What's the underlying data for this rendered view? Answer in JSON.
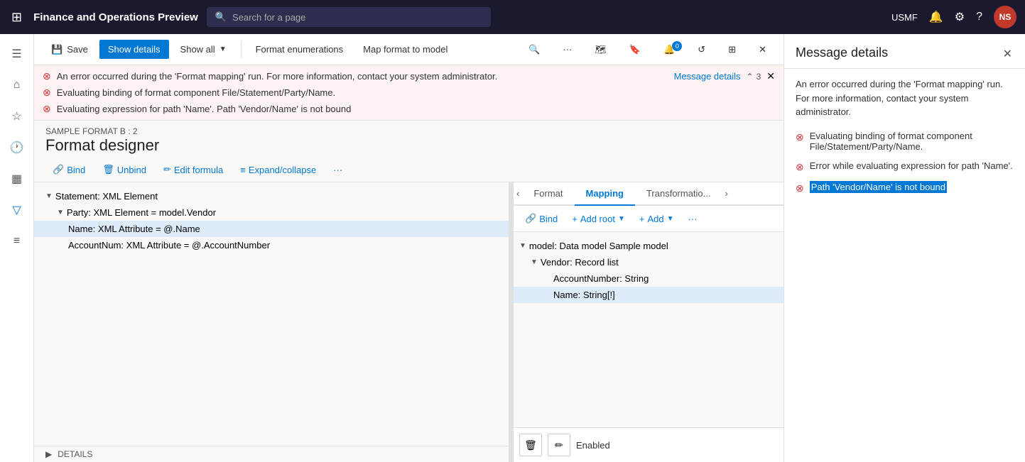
{
  "app": {
    "title": "Finance and Operations Preview",
    "nav_icon": "⊞",
    "search_placeholder": "Search for a page",
    "usmf_label": "USMF",
    "avatar_initials": "NS"
  },
  "sidebar": {
    "items": [
      {
        "icon": "☰",
        "name": "menu"
      },
      {
        "icon": "⌂",
        "name": "home"
      },
      {
        "icon": "☆",
        "name": "favorites"
      },
      {
        "icon": "⏱",
        "name": "recent"
      },
      {
        "icon": "▦",
        "name": "workspaces"
      },
      {
        "icon": "≡",
        "name": "modules"
      }
    ]
  },
  "toolbar": {
    "save_label": "Save",
    "show_details_label": "Show details",
    "show_all_label": "Show all",
    "format_enums_label": "Format enumerations",
    "map_format_label": "Map format to model"
  },
  "error_banner": {
    "error1": "An error occurred during the 'Format mapping' run. For more information, contact your system administrator.",
    "error2": "Evaluating binding of format component File/Statement/Party/Name.",
    "error3": "Evaluating expression for path 'Name'.  Path 'Vendor/Name' is not bound",
    "message_details_link": "Message details",
    "error_count": "3"
  },
  "designer": {
    "subtitle": "SAMPLE FORMAT B : 2",
    "title": "Format designer"
  },
  "designer_toolbar": {
    "bind_label": "Bind",
    "unbind_label": "Unbind",
    "edit_formula_label": "Edit formula",
    "expand_collapse_label": "Expand/collapse"
  },
  "format_tree": {
    "items": [
      {
        "label": "Statement: XML Element",
        "level": 0,
        "has_arrow": true,
        "arrow": "▼"
      },
      {
        "label": "Party: XML Element = model.Vendor",
        "level": 1,
        "has_arrow": true,
        "arrow": "▼"
      },
      {
        "label": "Name: XML Attribute = @.Name",
        "level": 2,
        "has_arrow": false,
        "selected": true
      },
      {
        "label": "AccountNum: XML Attribute = @.AccountNumber",
        "level": 2,
        "has_arrow": false
      }
    ]
  },
  "mapping_tabs": {
    "format_label": "Format",
    "mapping_label": "Mapping",
    "transformation_label": "Transformatio..."
  },
  "mapping_toolbar": {
    "bind_label": "Bind",
    "add_root_label": "Add root",
    "add_label": "Add"
  },
  "mapping_tree": {
    "items": [
      {
        "label": "model: Data model Sample model",
        "level": 0,
        "has_arrow": true,
        "arrow": "▼"
      },
      {
        "label": "Vendor: Record list",
        "level": 1,
        "has_arrow": true,
        "arrow": "▼"
      },
      {
        "label": "AccountNumber: String",
        "level": 2,
        "has_arrow": false
      },
      {
        "label": "Name: String[!]",
        "level": 2,
        "has_arrow": false,
        "selected": true
      }
    ]
  },
  "mapping_bottom": {
    "delete_icon": "🗑",
    "edit_icon": "✏",
    "enabled_label": "Enabled"
  },
  "details_row": {
    "label": "DETAILS",
    "arrow": "▶"
  },
  "message_panel": {
    "title": "Message details",
    "description": "An error occurred during the 'Format mapping' run. For more information, contact your system administrator.",
    "errors": [
      {
        "text": "Evaluating binding of format component File/Statement/Party/Name.",
        "highlighted": false
      },
      {
        "text": "Error while evaluating expression for path 'Name'.",
        "highlighted": false
      },
      {
        "text": "Path 'Vendor/Name' is not bound",
        "highlighted": true
      }
    ]
  }
}
